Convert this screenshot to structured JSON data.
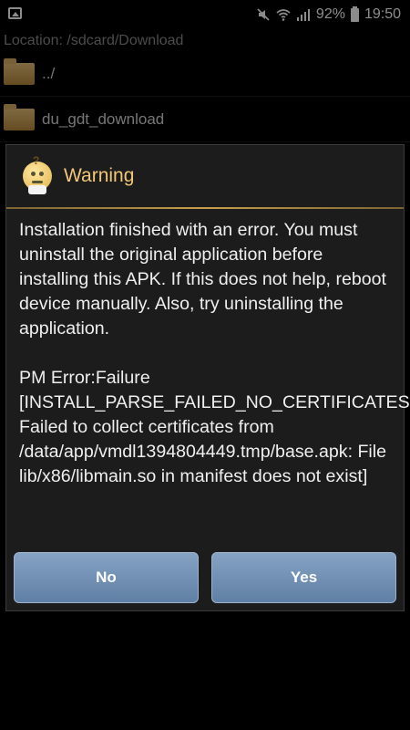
{
  "status_bar": {
    "left_icon": "image-icon",
    "mute_icon": "mute-icon",
    "wifi_icon": "wifi-icon",
    "signal_icon": "signal-icon",
    "battery_percent": "92%",
    "battery_level": 0.92,
    "time": "19:50"
  },
  "file_browser": {
    "location": "Location: /sdcard/Download",
    "items": [
      {
        "icon": "folder-icon",
        "name": "../"
      },
      {
        "icon": "folder-icon",
        "name": "du_gdt_download"
      }
    ]
  },
  "dialog": {
    "icon": "warning-emoji-icon",
    "title": "Warning",
    "message": "Installation finished with an error. You must uninstall the original application before installing this APK. If this does not help, reboot device manually. Also, try uninstalling the application.\n\nPM Error:Failure [INSTALL_PARSE_FAILED_NO_CERTIFICATES: Failed to collect certificates from /data/app/vmdl1394804449.tmp/base.apk: File lib/x86/libmain.so in manifest does not exist]",
    "buttons": {
      "no": "No",
      "yes": "Yes"
    },
    "accent_color": "#f2c777",
    "button_color": "#7190b4"
  }
}
